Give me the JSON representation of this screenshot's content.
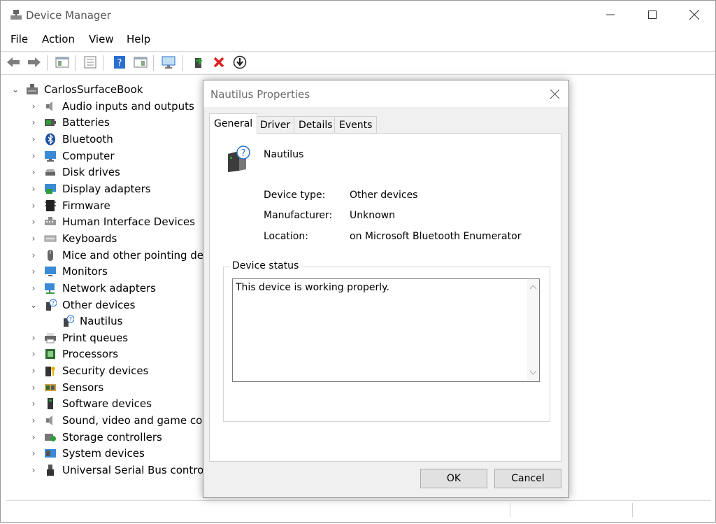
{
  "window": {
    "title": "Device Manager"
  },
  "menu": [
    "File",
    "Action",
    "View",
    "Help"
  ],
  "tree": {
    "root": "CarlosSurfaceBook",
    "categories": [
      {
        "label": "Audio inputs and outputs",
        "icon": "speaker-icon"
      },
      {
        "label": "Batteries",
        "icon": "battery-icon"
      },
      {
        "label": "Bluetooth",
        "icon": "bluetooth-icon"
      },
      {
        "label": "Computer",
        "icon": "computer-icon"
      },
      {
        "label": "Disk drives",
        "icon": "disk-drive-icon"
      },
      {
        "label": "Display adapters",
        "icon": "display-adapter-icon"
      },
      {
        "label": "Firmware",
        "icon": "firmware-icon"
      },
      {
        "label": "Human Interface Devices",
        "icon": "hid-icon"
      },
      {
        "label": "Keyboards",
        "icon": "keyboard-icon"
      },
      {
        "label": "Mice and other pointing devi",
        "icon": "mouse-icon"
      },
      {
        "label": "Monitors",
        "icon": "monitor-icon"
      },
      {
        "label": "Network adapters",
        "icon": "network-icon"
      },
      {
        "label": "Other devices",
        "icon": "unknown-device-icon",
        "expanded": true,
        "children": [
          "Nautilus"
        ]
      },
      {
        "label": "Print queues",
        "icon": "printer-icon"
      },
      {
        "label": "Processors",
        "icon": "processor-icon"
      },
      {
        "label": "Security devices",
        "icon": "security-key-icon"
      },
      {
        "label": "Sensors",
        "icon": "sensor-icon"
      },
      {
        "label": "Software devices",
        "icon": "software-device-icon"
      },
      {
        "label": "Sound, video and game cont",
        "icon": "speaker-icon"
      },
      {
        "label": "Storage controllers",
        "icon": "storage-controller-icon"
      },
      {
        "label": "System devices",
        "icon": "system-device-icon"
      },
      {
        "label": "Universal Serial Bus controlle",
        "icon": "usb-icon"
      }
    ]
  },
  "dialog": {
    "title": "Nautilus Properties",
    "tabs": [
      "General",
      "Driver",
      "Details",
      "Events"
    ],
    "active_tab": "General",
    "device_name": "Nautilus",
    "properties": [
      {
        "label": "Device type:",
        "value": "Other devices"
      },
      {
        "label": "Manufacturer:",
        "value": "Unknown"
      },
      {
        "label": "Location:",
        "value": "on Microsoft Bluetooth Enumerator"
      }
    ],
    "status_group_title": "Device status",
    "status_text": "This device is working properly.",
    "ok_label": "OK",
    "cancel_label": "Cancel"
  },
  "colors": {
    "accent_blue": "#2a6fd0",
    "error_red": "#e02020",
    "green": "#2d9d3a"
  }
}
